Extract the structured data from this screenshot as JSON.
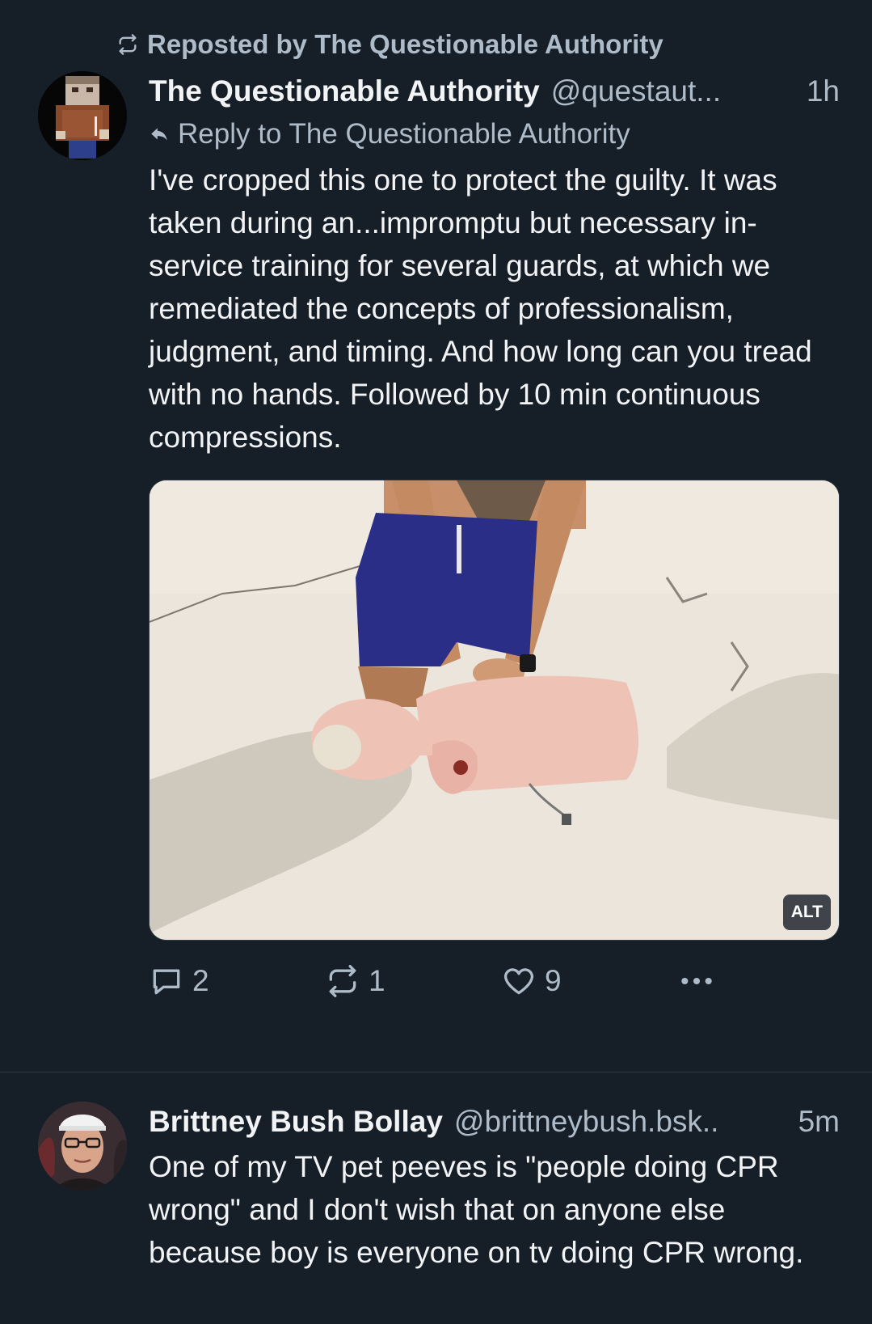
{
  "colors": {
    "background": "#161e27",
    "primary_text": "#f1f3f5",
    "secondary_text": "#aebbc9",
    "divider": "#2e3a47"
  },
  "posts": [
    {
      "repost_label": "Reposted by The Questionable Authority",
      "repost_icon": "repost-icon",
      "display_name": "The Questionable Authority",
      "handle": "@questaut...",
      "timestamp": "1h",
      "reply_to": "Reply to The Questionable Authority",
      "reply_icon": "reply-arrow-icon",
      "text": "I've cropped this one to protect the guilty. It was taken during an...impromptu but necessary in-service training for several guards, at which we remediated the concepts of professionalism, judgment, and timing. And how long can you tread with no hands. Followed by 10 min continuous compressions.",
      "media": {
        "alt_badge": "ALT"
      },
      "counts": {
        "replies": "2",
        "reposts": "1",
        "likes": "9"
      }
    },
    {
      "display_name": "Brittney Bush Bollay",
      "handle": "@brittneybush.bsk..",
      "timestamp": "5m",
      "text": "One of my TV pet peeves is \"people doing CPR wrong\" and I don't wish that on anyone else because boy is everyone on tv doing CPR wrong."
    }
  ]
}
